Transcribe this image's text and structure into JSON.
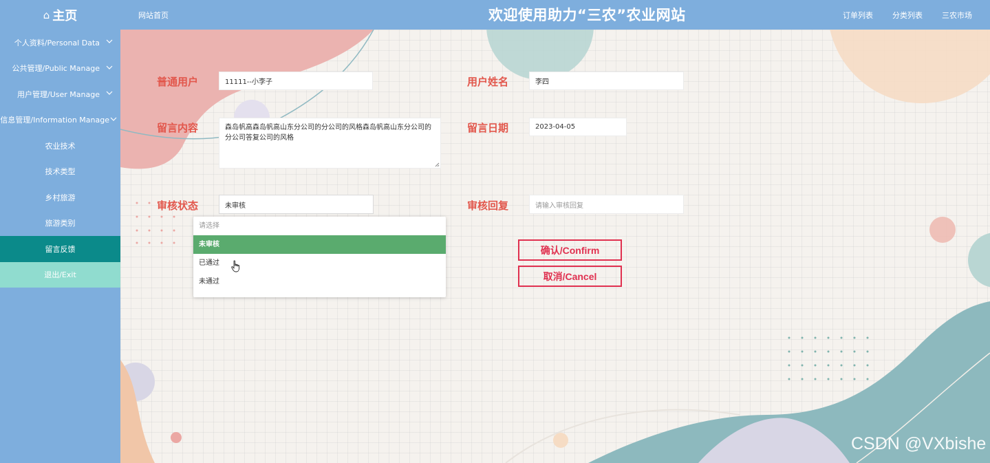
{
  "header": {
    "brand_icon": "home-icon",
    "brand_label": "主页",
    "home_link": "网站首页",
    "site_title": "欢迎使用助力“三农”农业网站",
    "right_links": [
      "订单列表",
      "分类列表",
      "三农市场"
    ]
  },
  "sidebar": {
    "items": [
      {
        "label": "个人资料/Personal Data",
        "expandable": true
      },
      {
        "label": "公共管理/Public Manage",
        "expandable": true
      },
      {
        "label": "用户管理/User Manage",
        "expandable": true
      },
      {
        "label": "信息管理/Information Manage",
        "expandable": true
      },
      {
        "label": "农业技术",
        "expandable": false
      },
      {
        "label": "技术类型",
        "expandable": false
      },
      {
        "label": "乡村旅游",
        "expandable": false
      },
      {
        "label": "旅游类别",
        "expandable": false
      },
      {
        "label": "留言反馈",
        "expandable": false,
        "active": true
      },
      {
        "label": "退出/Exit",
        "expandable": false
      }
    ]
  },
  "form": {
    "user_label": "普通用户",
    "user_value": "11111--小李子",
    "name_label": "用户姓名",
    "name_value": "李四",
    "content_label": "留言内容",
    "content_value": "森岛帆高森岛帆高山东分公司的分公司的风格森岛帆高山东分公司的分公司答复公司的风格",
    "date_label": "留言日期",
    "date_value": "2023-04-05",
    "status_label": "审核状态",
    "status_value": "未审核",
    "reply_label": "审核回复",
    "reply_placeholder": "请输入审核回复",
    "status_options": {
      "hint": "请选择",
      "options": [
        "未审核",
        "已通过",
        "未通过"
      ],
      "selected": "未审核"
    },
    "confirm_label": "确认/Confirm",
    "cancel_label": "取消/Cancel"
  },
  "watermark": "CSDN @VXbishe",
  "colors": {
    "header_bg": "#7eaedd",
    "sidebar_active": "#0b8a8a",
    "sidebar_exit": "#90dccf",
    "label_red": "#e2574c",
    "button_red": "#e0304f",
    "option_selected": "#5aab6e"
  }
}
